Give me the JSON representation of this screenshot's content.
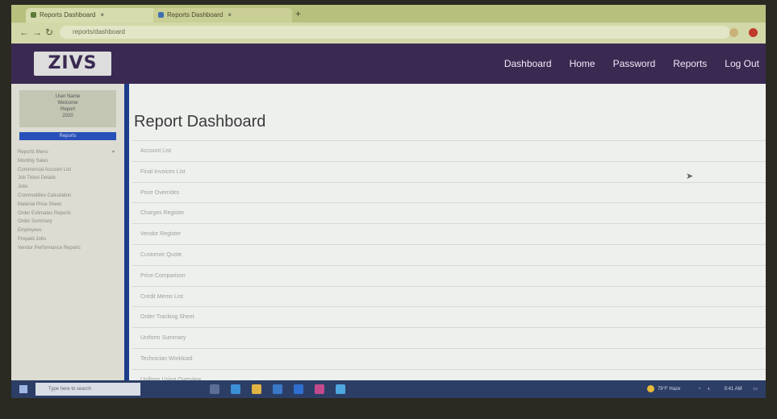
{
  "browser": {
    "tabs": [
      {
        "label": "Reports Dashboard",
        "active": true
      },
      {
        "label": "Reports Dashboard",
        "active": false
      }
    ],
    "url": "reports/dashboard"
  },
  "header": {
    "logo_text": "ZIVS",
    "nav": [
      "Dashboard",
      "Home",
      "Password",
      "Reports",
      "Log Out"
    ]
  },
  "sidebar": {
    "user_lines": [
      "User Name",
      "Welcome",
      "Report",
      "2020"
    ],
    "active_label": "Reports",
    "items": [
      "Reports Menu",
      "Monthly Sales",
      "Commercial Account List",
      "Job Ticket Details",
      "Jobs",
      "Commodities Calculation",
      "Material Price Sheet",
      "Order Estimates Reports",
      "Order Summary",
      "Employees",
      "Prepaid Jobs",
      "Vendor Performance Reports"
    ]
  },
  "main": {
    "title": "Report Dashboard",
    "reports": [
      "Account List",
      "Final Invoices List",
      "Price Overrides",
      "Charges Register",
      "Vendor Register",
      "Customer Quote",
      "Price Comparison",
      "Credit Memo List",
      "Order Tracking Sheet",
      "Uniform Summary",
      "Technician Workload",
      "Uniform Using Overview"
    ]
  },
  "taskbar": {
    "search_placeholder": "Type here to search",
    "weather": "79°F Haze",
    "time": "9:41 AM"
  },
  "colors": {
    "header_bg": "#3a2a52",
    "sidebar_accent": "#2850b8",
    "divider": "#1d3c8c",
    "taskbar_bg": "#2c3e66"
  }
}
